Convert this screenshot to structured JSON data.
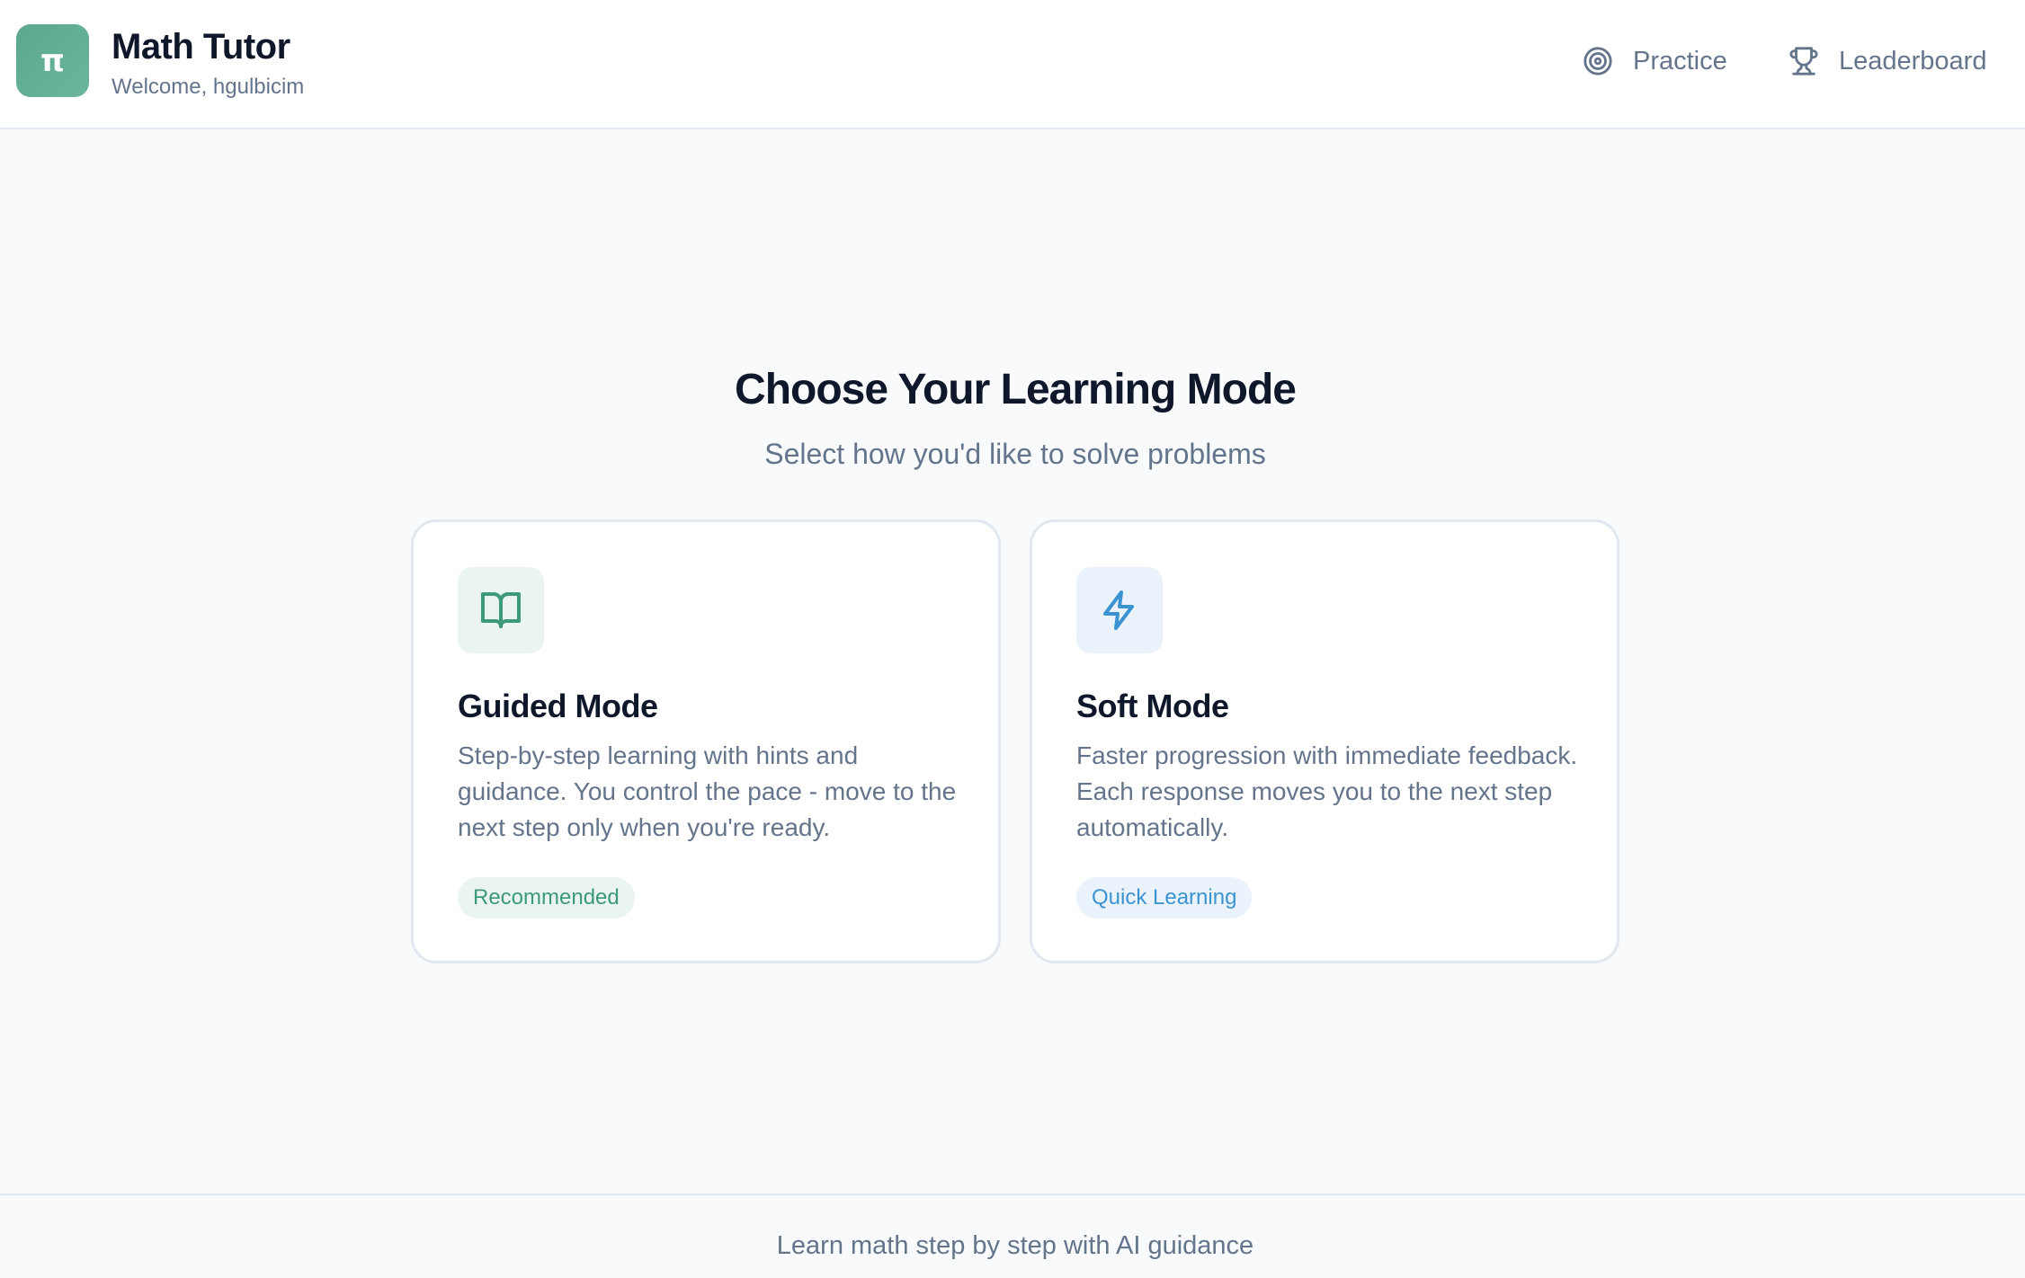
{
  "header": {
    "logo_glyph": "π",
    "title": "Math Tutor",
    "welcome": "Welcome, hgulbicim",
    "nav": [
      {
        "label": "Practice",
        "icon": "target-icon"
      },
      {
        "label": "Leaderboard",
        "icon": "trophy-icon"
      }
    ]
  },
  "main": {
    "title": "Choose Your Learning Mode",
    "subtitle": "Select how you'd like to solve problems",
    "cards": [
      {
        "title": "Guided Mode",
        "description": "Step-by-step learning with hints and guidance. You control the pace - move to the next step only when you're ready.",
        "badge": "Recommended",
        "icon": "book-open-icon",
        "accent": "#3d9a78"
      },
      {
        "title": "Soft Mode",
        "description": "Faster progression with immediate feedback. Each response moves you to the next step automatically.",
        "badge": "Quick Learning",
        "icon": "lightning-icon",
        "accent": "#3b94d1"
      }
    ]
  },
  "footer": {
    "text": "Learn math step by step with AI guidance"
  },
  "colors": {
    "brand": "#5aa88c",
    "guided_accent": "#3d9a78",
    "soft_accent": "#3b94d1",
    "text_primary": "#0f172a",
    "text_muted": "#64748b",
    "background": "#f8fafc"
  }
}
